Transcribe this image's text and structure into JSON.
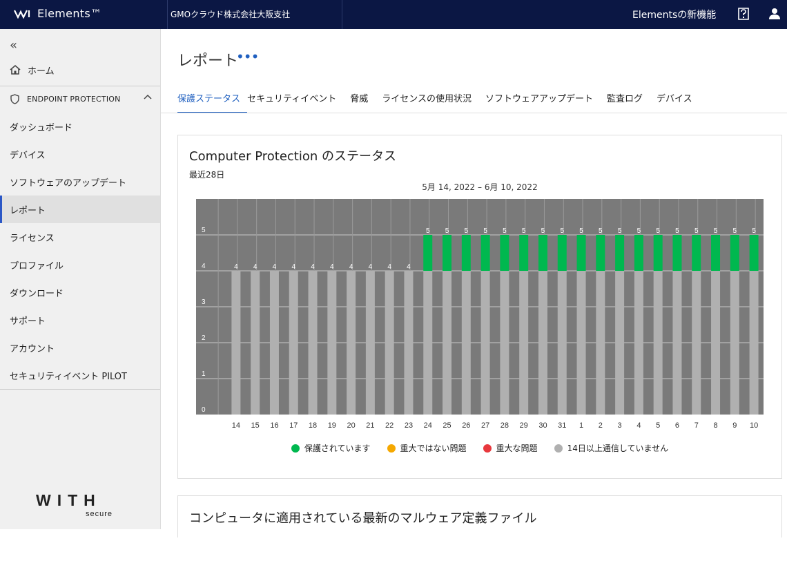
{
  "header": {
    "brand": "Elements™",
    "org": "GMOクラウド株式会社大阪支社",
    "whats_new": "Elementsの新機能",
    "bg_color": "#0b1744"
  },
  "sidebar": {
    "home": "ホーム",
    "section": "ENDPOINT PROTECTION",
    "items": [
      {
        "label": "ダッシュボード"
      },
      {
        "label": "デバイス"
      },
      {
        "label": "ソフトウェアのアップデート"
      },
      {
        "label": "レポート"
      },
      {
        "label": "ライセンス"
      },
      {
        "label": "プロファイル"
      },
      {
        "label": "ダウンロード"
      },
      {
        "label": "サポート"
      },
      {
        "label": "アカウント"
      },
      {
        "label": "セキュリティイベント PILOT"
      }
    ],
    "active_index": 3,
    "logo_text": "WITH",
    "logo_sub": "secure"
  },
  "main": {
    "title": "レポート",
    "tabs": [
      "保護ステータス",
      "セキュリティイベント",
      "脅威",
      "ライセンスの使用状況",
      "ソフトウェアアップデート",
      "監査ログ",
      "デバイス"
    ],
    "active_tab": 0,
    "card": {
      "title": "Computer Protection のステータス",
      "subtitle": "最近28日",
      "range": "5月 14, 2022 – 6月 10, 2022"
    },
    "card2_title": "コンピュータに適用されている最新のマルウェア定義ファイル"
  },
  "chart_data": {
    "type": "bar",
    "stacked": true,
    "categories": [
      "14",
      "15",
      "16",
      "17",
      "18",
      "19",
      "20",
      "21",
      "22",
      "23",
      "24",
      "25",
      "26",
      "27",
      "28",
      "29",
      "30",
      "31",
      "1",
      "2",
      "3",
      "4",
      "5",
      "6",
      "7",
      "8",
      "9",
      "10"
    ],
    "series": [
      {
        "name": "保護されています",
        "color": "#00b84f",
        "values": [
          0,
          0,
          0,
          0,
          0,
          0,
          0,
          0,
          0,
          0,
          1,
          1,
          1,
          1,
          1,
          1,
          1,
          1,
          1,
          1,
          1,
          1,
          1,
          1,
          1,
          1,
          1,
          1
        ]
      },
      {
        "name": "重大ではない問題",
        "color": "#f5a800",
        "values": [
          0,
          0,
          0,
          0,
          0,
          0,
          0,
          0,
          0,
          0,
          0,
          0,
          0,
          0,
          0,
          0,
          0,
          0,
          0,
          0,
          0,
          0,
          0,
          0,
          0,
          0,
          0,
          0
        ]
      },
      {
        "name": "重大な問題",
        "color": "#e8383d",
        "values": [
          0,
          0,
          0,
          0,
          0,
          0,
          0,
          0,
          0,
          0,
          0,
          0,
          0,
          0,
          0,
          0,
          0,
          0,
          0,
          0,
          0,
          0,
          0,
          0,
          0,
          0,
          0,
          0
        ]
      },
      {
        "name": "14日以上通信していません",
        "color": "#b0b0b0",
        "values": [
          4,
          4,
          4,
          4,
          4,
          4,
          4,
          4,
          4,
          4,
          4,
          4,
          4,
          4,
          4,
          4,
          4,
          4,
          4,
          4,
          4,
          4,
          4,
          4,
          4,
          4,
          4,
          4
        ]
      }
    ],
    "totals": [
      4,
      4,
      4,
      4,
      4,
      4,
      4,
      4,
      4,
      4,
      5,
      5,
      5,
      5,
      5,
      5,
      5,
      5,
      5,
      5,
      5,
      5,
      5,
      5,
      5,
      5,
      5,
      5
    ],
    "ylim": [
      0,
      6
    ],
    "yticks": [
      0,
      1,
      2,
      3,
      4,
      5
    ],
    "plot_bg": "#7a7a7a",
    "grid": true,
    "legend_position": "bottom"
  }
}
